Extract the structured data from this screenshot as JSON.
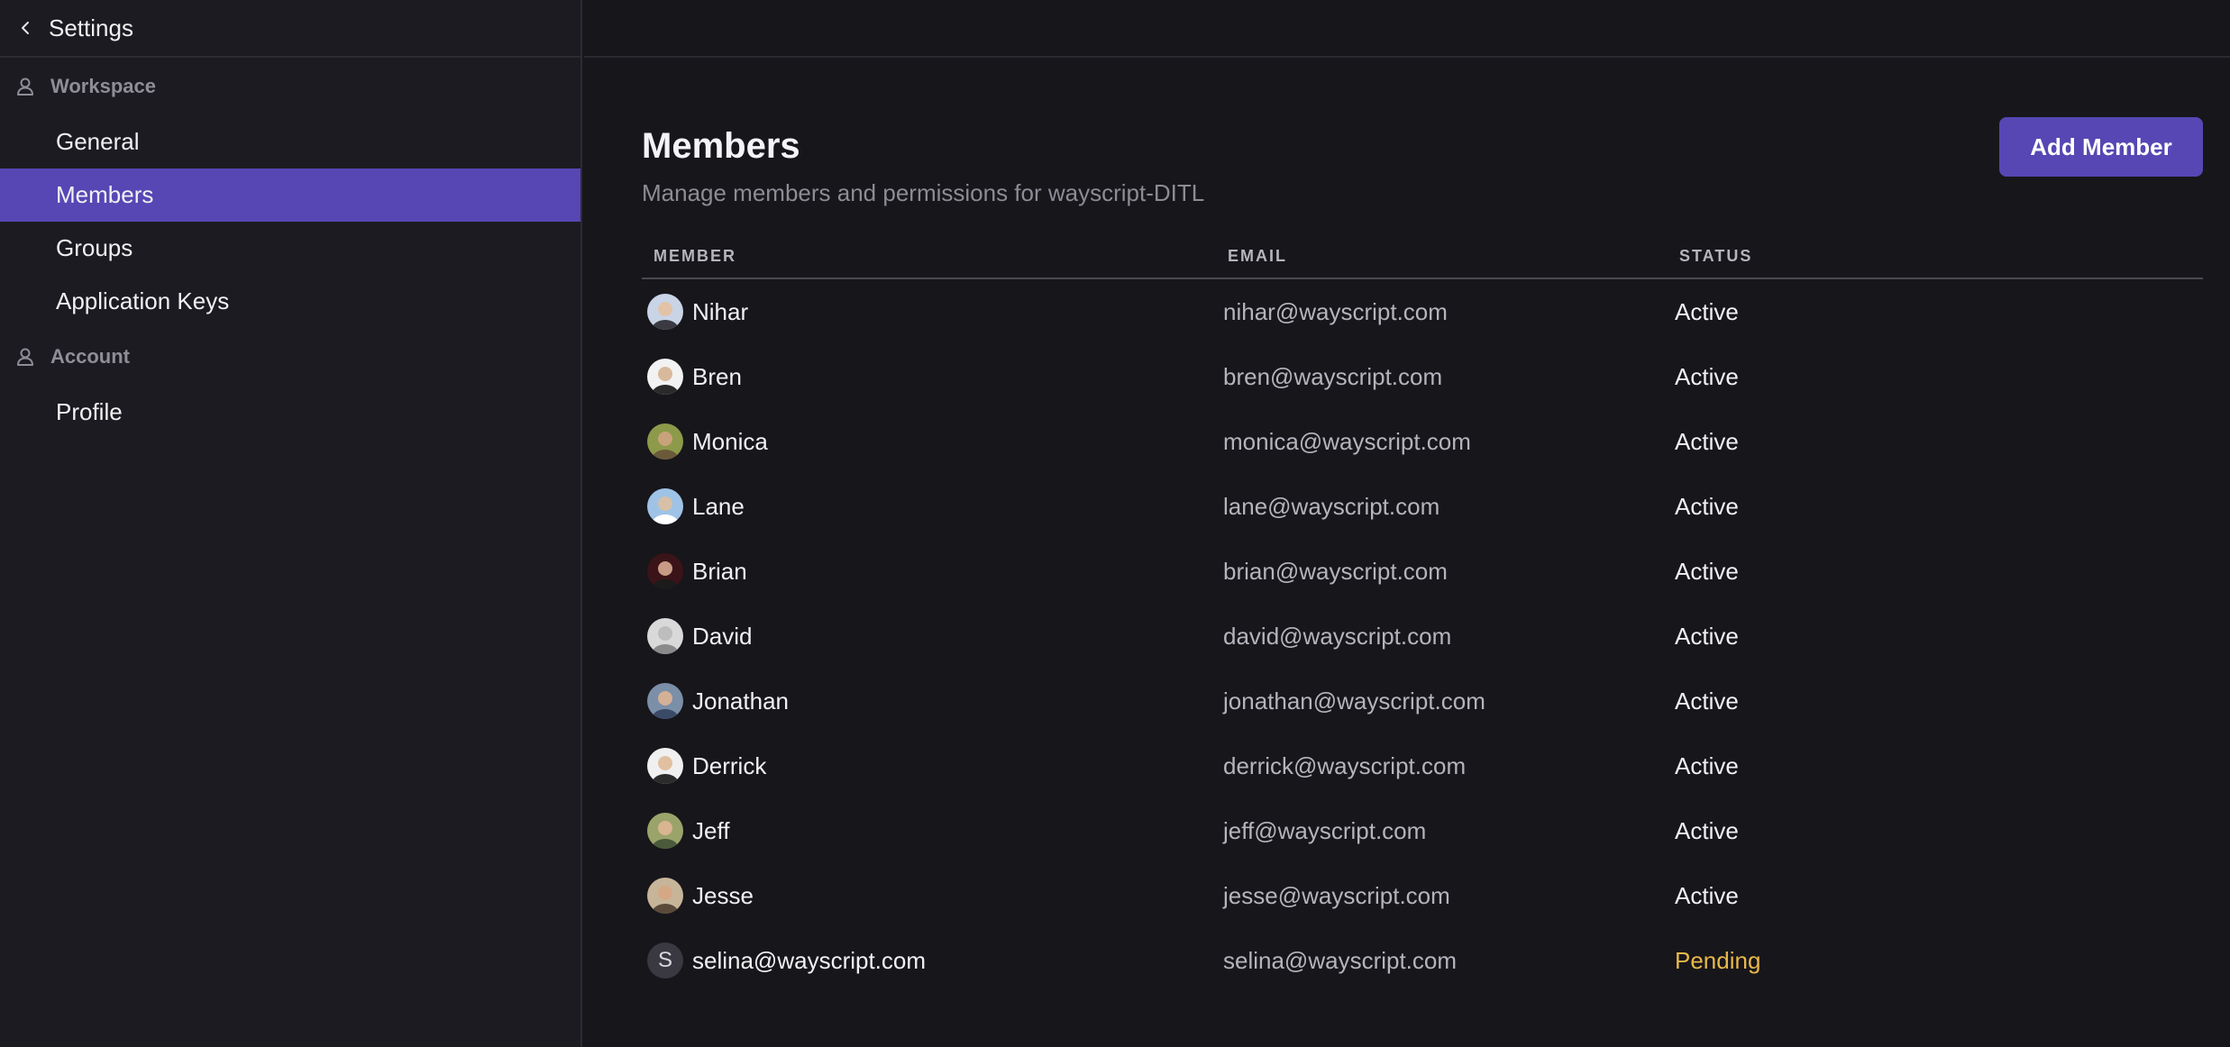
{
  "sidebar": {
    "title": "Settings",
    "sections": [
      {
        "label": "Workspace",
        "items": [
          "General",
          "Members",
          "Groups",
          "Application Keys"
        ]
      },
      {
        "label": "Account",
        "items": [
          "Profile"
        ]
      }
    ],
    "active_item": "Members"
  },
  "main": {
    "title": "Members",
    "subtitle": "Manage members and permissions for wayscript-DITL",
    "add_button": "Add Member",
    "columns": [
      "MEMBER",
      "EMAIL",
      "STATUS"
    ],
    "members": [
      {
        "name": "Nihar",
        "email": "nihar@wayscript.com",
        "status": "Active"
      },
      {
        "name": "Bren",
        "email": "bren@wayscript.com",
        "status": "Active"
      },
      {
        "name": "Monica",
        "email": "monica@wayscript.com",
        "status": "Active"
      },
      {
        "name": "Lane",
        "email": "lane@wayscript.com",
        "status": "Active"
      },
      {
        "name": "Brian",
        "email": "brian@wayscript.com",
        "status": "Active"
      },
      {
        "name": "David",
        "email": "david@wayscript.com",
        "status": "Active"
      },
      {
        "name": "Jonathan",
        "email": "jonathan@wayscript.com",
        "status": "Active"
      },
      {
        "name": "Derrick",
        "email": "derrick@wayscript.com",
        "status": "Active"
      },
      {
        "name": "Jeff",
        "email": "jeff@wayscript.com",
        "status": "Active"
      },
      {
        "name": "Jesse",
        "email": "jesse@wayscript.com",
        "status": "Active"
      },
      {
        "name": "selina@wayscript.com",
        "email": "selina@wayscript.com",
        "status": "Pending",
        "avatar_letter": "S"
      }
    ]
  },
  "colors": {
    "accent": "#5647b4",
    "pending": "#e8b84a",
    "background": "#17161b",
    "sidebar_background": "#1c1b21"
  }
}
